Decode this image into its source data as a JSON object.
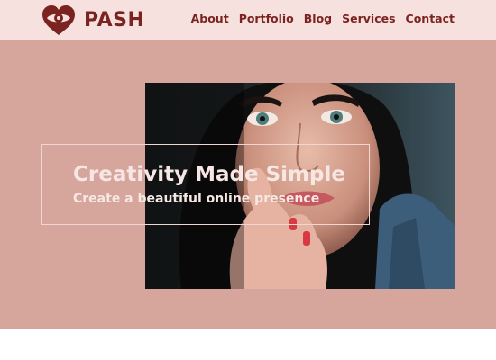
{
  "brand": {
    "name": "PASH",
    "logo_icon": "heart-eye-icon",
    "color": "#7b2321"
  },
  "nav": {
    "items": [
      "About",
      "Portfolio",
      "Blog",
      "Services",
      "Contact"
    ]
  },
  "hero": {
    "title": "Creativity Made Simple",
    "subtitle": "Create a beautiful online presence",
    "background_color": "#d6a59c",
    "photo_subject": "portrait-of-woman"
  },
  "colors": {
    "header_bg": "#f7e1de",
    "hero_bg": "#d6a59c",
    "accent": "#7b2321"
  }
}
